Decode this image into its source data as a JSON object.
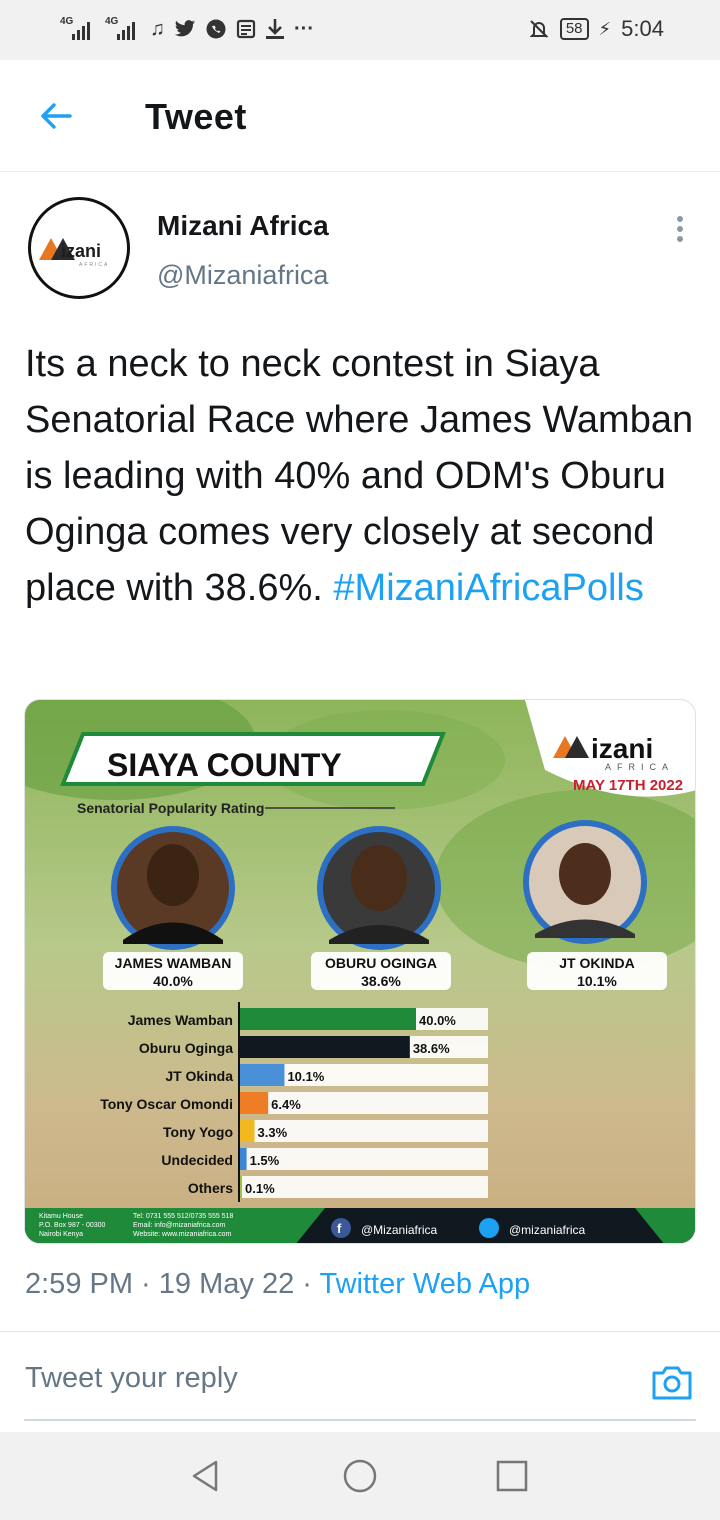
{
  "status_bar": {
    "net1": "4G",
    "net2": "4G",
    "icons": [
      "signal-icon",
      "signal-icon",
      "music-icon",
      "twitter-icon",
      "whatsapp-icon",
      "news-icon",
      "download-icon",
      "more-icon"
    ],
    "overflow": "···",
    "battery": "58",
    "time": "5:04"
  },
  "header": {
    "title": "Tweet"
  },
  "author": {
    "name": "Mizani Africa",
    "handle": "@Mizaniafrica"
  },
  "tweet": {
    "text": "Its a neck to neck contest in Siaya Senatorial Race where James Wamban is leading with 40% and ODM's Oburu Oginga comes very closely at second place with 38.6%. ",
    "hashtag": "#MizaniAfricaPolls"
  },
  "poll_image": {
    "brand": "Mizani",
    "brand_sub": "AFRICA",
    "date": "MAY 17TH 2022",
    "title": "SIAYA COUNTY",
    "subtitle": "Senatorial Popularity Rating",
    "candidates": [
      {
        "name": "JAMES WAMBAN",
        "pct": "40.0%"
      },
      {
        "name": "OBURU OGINGA",
        "pct": "38.6%"
      },
      {
        "name": "JT OKINDA",
        "pct": "10.1%"
      }
    ],
    "footer": {
      "address": [
        "Kitamu House",
        "P.O. Box 987 - 00300",
        "Nairobi Kenya"
      ],
      "contact": [
        "Tel: 0731 555 512/0735 555 518",
        "Email: info@mizaniafrica.com",
        "Website: www.mizaniafrica.com"
      ],
      "facebook": "@Mizaniafrica",
      "twitter": "@mizaniafrica"
    },
    "colors": {
      "green": "#1e8a3a",
      "dark": "#101820",
      "blue": "#4a90d9",
      "orange": "#ee7d25",
      "yellow": "#f2b81f",
      "light_blue": "#3b86d6",
      "lime": "#9bc53d"
    }
  },
  "chart_data": {
    "type": "bar",
    "orientation": "horizontal",
    "categories": [
      "James Wamban",
      "Oburu Oginga",
      "JT Okinda",
      "Tony Oscar Omondi",
      "Tony Yogo",
      "Undecided",
      "Others"
    ],
    "values": [
      40.0,
      38.6,
      10.1,
      6.4,
      3.3,
      1.5,
      0.1
    ],
    "labels": [
      "40.0%",
      "38.6%",
      "10.1%",
      "6.4%",
      "3.3%",
      "1.5%",
      "0.1%"
    ],
    "bar_colors": [
      "#1e8a3a",
      "#101820",
      "#4a90d9",
      "#ee7d25",
      "#f2b81f",
      "#3b86d6",
      "#9bc53d"
    ],
    "xlim": [
      0,
      40
    ]
  },
  "meta": {
    "time": "2:59 PM",
    "sep": " · ",
    "date": "19 May 22",
    "app": "Twitter Web App"
  },
  "reply": {
    "placeholder": "Tweet your reply"
  }
}
